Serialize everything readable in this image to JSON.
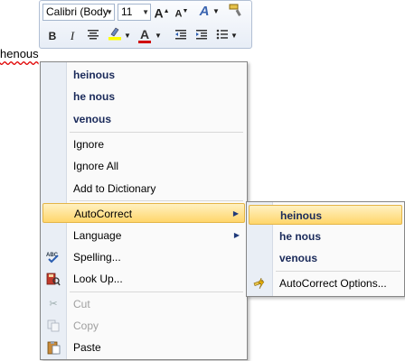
{
  "mini_toolbar": {
    "font_name": "Calibri (Body",
    "font_size": "11",
    "grow_font_icon": "A",
    "shrink_font_icon": "A",
    "styles_icon": "A",
    "bold_label": "B",
    "italic_label": "I",
    "font_color_label": "A",
    "highlight_color": "#ffff00",
    "font_color": "#d00000"
  },
  "document": {
    "misspelled_word": "henous"
  },
  "context_menu": {
    "suggestions": [
      "heinous",
      "he nous",
      "venous"
    ],
    "ignore": "Ignore",
    "ignore_all": "Ignore All",
    "add_to_dictionary": "Add to Dictionary",
    "autocorrect": "AutoCorrect",
    "language": "Language",
    "spelling": "Spelling...",
    "look_up": "Look Up...",
    "cut": "Cut",
    "copy": "Copy",
    "paste": "Paste"
  },
  "autocorrect_submenu": {
    "suggestions": [
      "heinous",
      "he nous",
      "venous"
    ],
    "options": "AutoCorrect Options..."
  },
  "colors": {
    "highlight_bg": "#ffd66b",
    "gutter": "#e9eef5",
    "suggestion_text": "#1a2a5a"
  }
}
